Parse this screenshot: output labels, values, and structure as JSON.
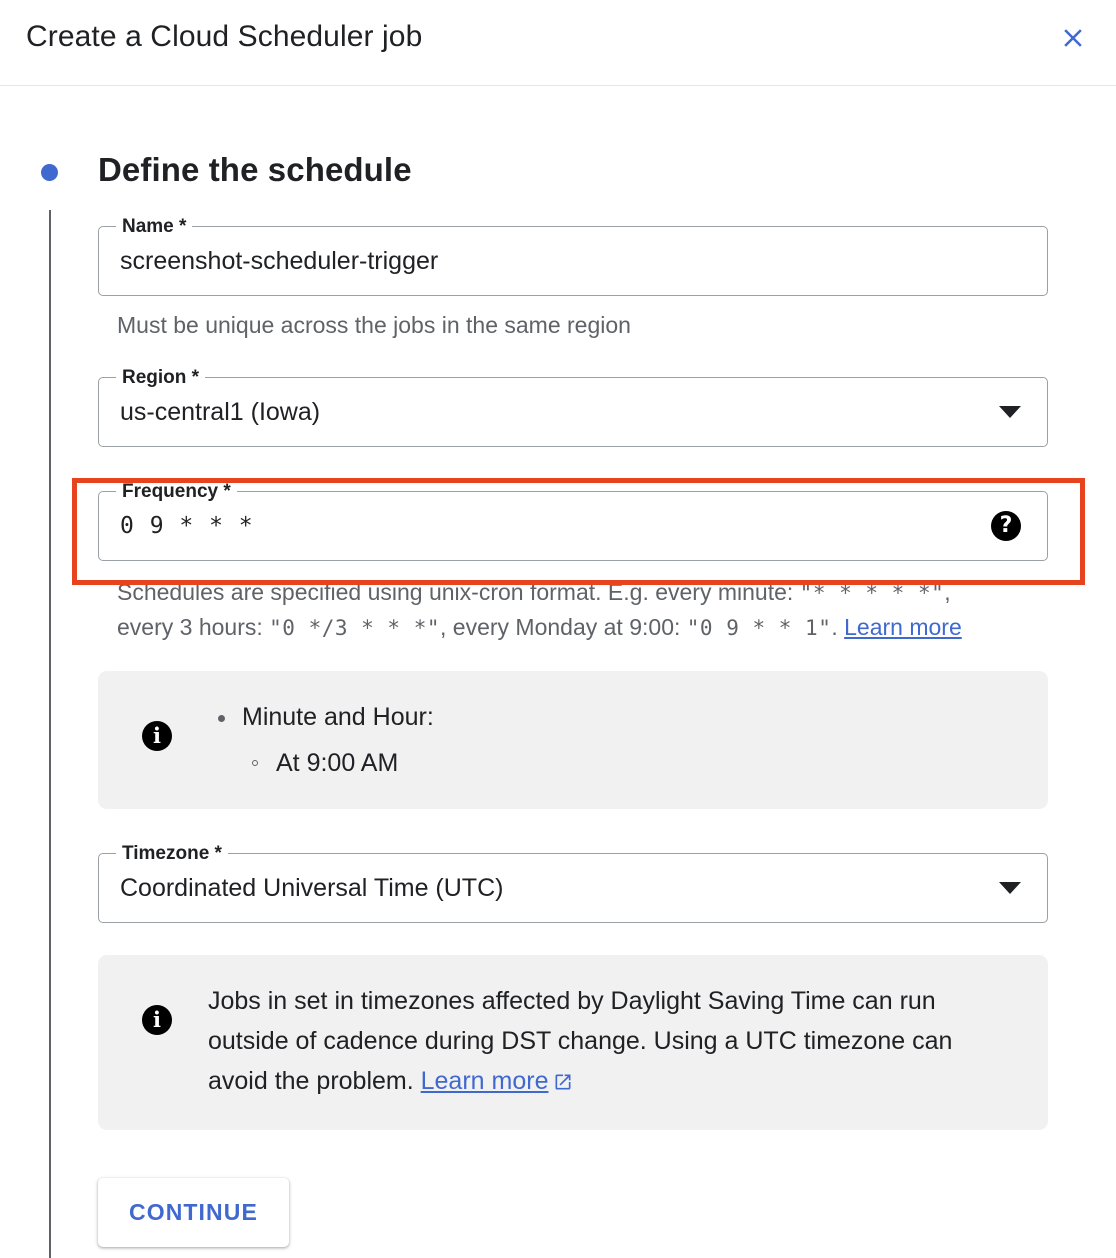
{
  "header": {
    "title": "Create a Cloud Scheduler job",
    "close_icon": "close-icon"
  },
  "step": {
    "heading": "Define the schedule"
  },
  "fields": {
    "name": {
      "label": "Name *",
      "value": "screenshot-scheduler-trigger",
      "helper": "Must be unique across the jobs in the same region"
    },
    "region": {
      "label": "Region *",
      "value": "us-central1 (Iowa)",
      "arrow_icon": "chevron-down-icon"
    },
    "frequency": {
      "label": "Frequency *",
      "value": "0 9 * * *",
      "help_icon": "help-circle-icon",
      "helper_prefix": "Schedules are specified using unix-cron format. E.g. every minute: ",
      "helper_example_1": "\"* * * * *\"",
      "helper_mid_1": ", every 3 hours: ",
      "helper_example_2": "\"0 */3 * * *\"",
      "helper_mid_2": ", every Monday at 9:00: ",
      "helper_example_3": "\"0 9 * * 1\"",
      "helper_suffix": ". ",
      "learn_more": "Learn more"
    },
    "timezone": {
      "label": "Timezone *",
      "value": "Coordinated Universal Time (UTC)",
      "arrow_icon": "chevron-down-icon"
    }
  },
  "schedule_info": {
    "icon": "info-circle-icon",
    "item": "Minute and Hour:",
    "subitem": "At 9:00 AM"
  },
  "dst_info": {
    "icon": "info-circle-icon",
    "text": "Jobs in set in timezones affected by Daylight Saving Time can run outside of cadence during DST change. Using a UTC timezone can avoid the problem. ",
    "learn_more": "Learn more",
    "external_icon": "external-link-icon"
  },
  "actions": {
    "continue_label": "CONTINUE"
  },
  "highlight": {
    "color": "#e8431f",
    "target": "frequency-field"
  },
  "colors": {
    "accent": "#4069cf",
    "text": "#202124",
    "muted": "#5f6368",
    "panel": "#f1f1f1",
    "border": "#9aa0a6"
  }
}
